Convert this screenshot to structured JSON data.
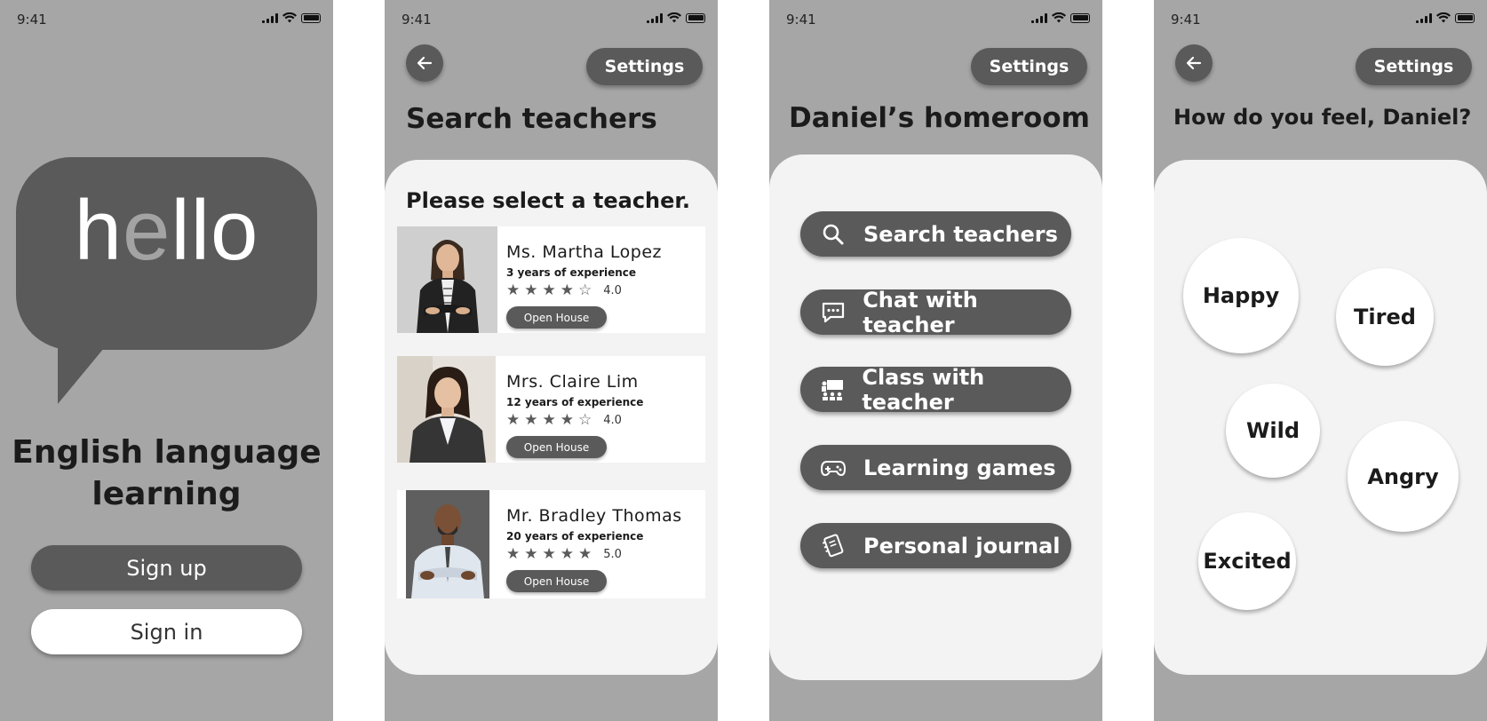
{
  "status": {
    "time": "9:41"
  },
  "welcome": {
    "logo_text": {
      "h": "h",
      "e": "e",
      "ll": "ll",
      "o": "o"
    },
    "title_line1": "English language",
    "title_line2": "learning",
    "signup_label": "Sign up",
    "signin_label": "Sign in"
  },
  "search": {
    "settings_label": "Settings",
    "title": "Search teachers",
    "prompt": "Please select a teacher.",
    "teachers": [
      {
        "name": "Ms. Martha Lopez",
        "experience": "3 years of experience",
        "rating": "4.0",
        "stars": 4,
        "button": "Open House"
      },
      {
        "name": "Mrs. Claire Lim",
        "experience": "12 years of experience",
        "rating": "4.0",
        "stars": 4,
        "button": "Open House"
      },
      {
        "name": "Mr. Bradley Thomas",
        "experience": "20 years of experience",
        "rating": "5.0",
        "stars": 5,
        "button": "Open House"
      }
    ]
  },
  "homeroom": {
    "settings_label": "Settings",
    "title": "Daniel’s homeroom",
    "menu": [
      {
        "label": "Search teachers",
        "icon": "search-icon"
      },
      {
        "label": "Chat with teacher",
        "icon": "chat-icon"
      },
      {
        "label": "Class with teacher",
        "icon": "classroom-icon"
      },
      {
        "label": "Learning games",
        "icon": "gamepad-icon"
      },
      {
        "label": "Personal journal",
        "icon": "journal-icon"
      }
    ]
  },
  "mood": {
    "settings_label": "Settings",
    "title": "How do you feel, Daniel?",
    "options": [
      "Happy",
      "Tired",
      "Wild",
      "Angry",
      "Excited"
    ]
  },
  "colors": {
    "phone_bg": "#a6a6a6",
    "dark_button": "#5a5a5a",
    "panel": "#f3f3f3"
  }
}
